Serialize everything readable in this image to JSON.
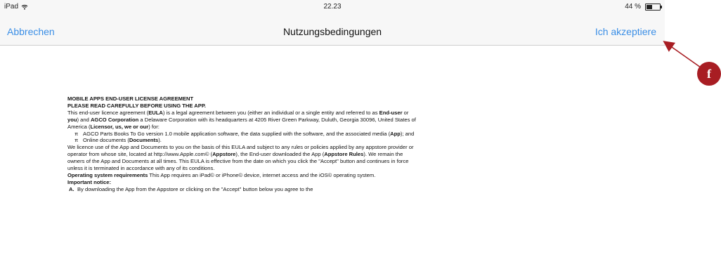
{
  "status_bar": {
    "device": "iPad",
    "wifi_icon": "wifi-icon",
    "time": "22.23",
    "battery_percent": "44 %",
    "battery_level": 0.44
  },
  "navbar": {
    "cancel_label": "Abbrechen",
    "title": "Nutzungsbedingungen",
    "accept_label": "Ich akzeptiere"
  },
  "document": {
    "heading1": "MOBILE APPS END-USER LICENSE AGREEMENT",
    "heading2": "PLEASE READ CAREFULLY BEFORE USING THE APP.",
    "para1": [
      "This end-user licence agreement (",
      "EULA",
      ") is a legal agreement between you (either an individual or a single entity and referred to as ",
      "End-user",
      " or ",
      "you",
      ") and ",
      "AGCO Corporation",
      " a Delaware Corporation with its headquarters at 4205 River Green Parkway, Duluth, Georgia 30096, United States of America (",
      "Licensor, us, we or our",
      ") for:"
    ],
    "bullets": [
      {
        "marker": "π",
        "parts": [
          "AGCO Parts Books To Go version 1.0 mobile application software, the data supplied with the software, and the associated media (",
          "App",
          "); and"
        ]
      },
      {
        "marker": "π",
        "parts": [
          "Online documents (",
          "Documents",
          ")."
        ]
      }
    ],
    "para2": [
      "We licence use of the App and Documents to you on the basis of this EULA and subject to any rules or policies applied by any appstore provider or operator from whose site, located at http://www.Apple.com© (",
      "Appstore",
      "), the End-user downloaded the App (",
      "Appstore Rules",
      "). We remain the owners of the App and Documents at all times.  This EULA is effective from the date on which you click the \"Accept\" button and continues in force unless it is terminated in accordance with any of its conditions."
    ],
    "os_requirements_label": "Operating system requirements",
    "os_requirements_text": " This App requires an iPad© or iPhone© device, internet access and the iOS© operating system.",
    "important_notice": "Important notice:",
    "notice_a_label": "A.",
    "notice_a_text": "By downloading the App from the Appstore or clicking on the \"Accept\" button below you agree to the"
  },
  "annotation": {
    "marker_label": "f",
    "accent_color": "#a81d23"
  }
}
